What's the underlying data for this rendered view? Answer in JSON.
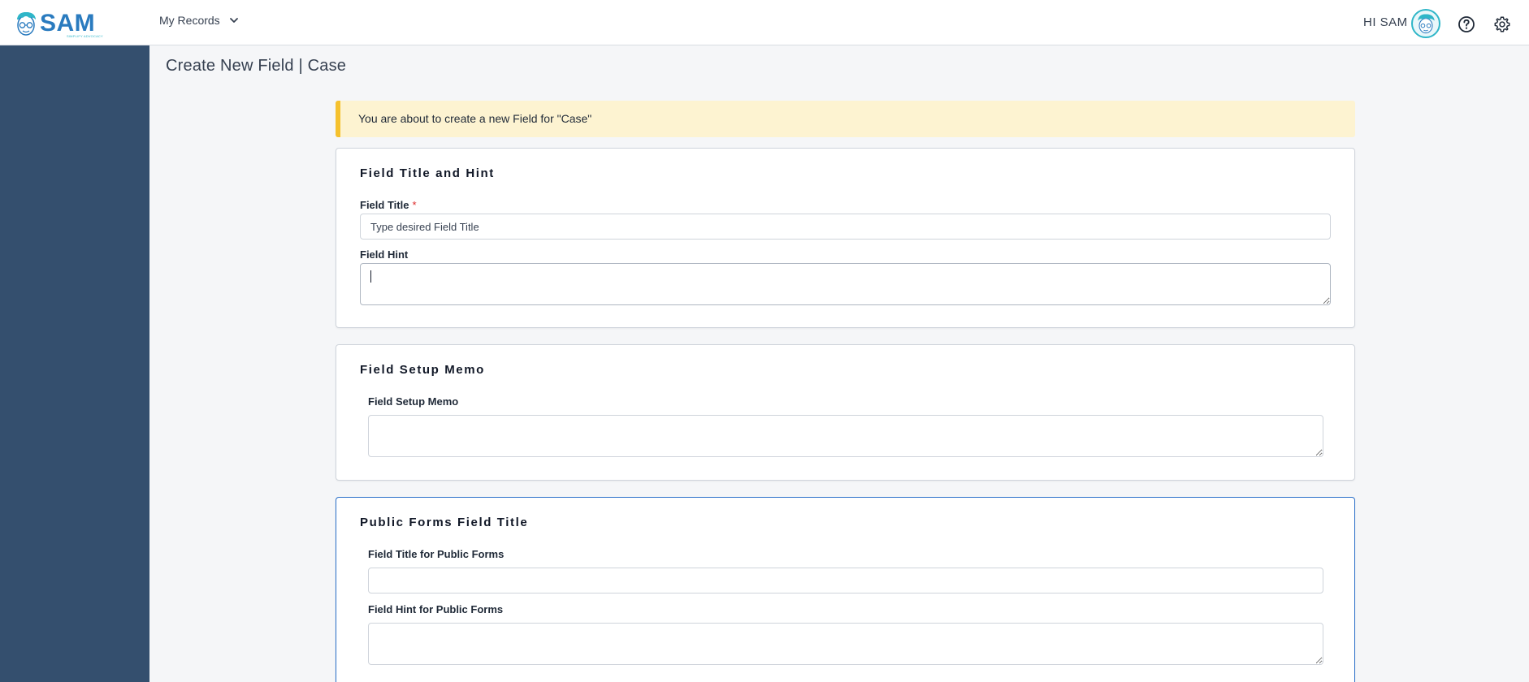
{
  "header": {
    "logo_text": "SAM",
    "logo_tagline": "SIMPLIFY ADVOCACY",
    "nav_menu_label": "My Records",
    "greeting": "HI SAM"
  },
  "page": {
    "title": "Create New Field | Case"
  },
  "alert": {
    "message": "You are about to create a new Field for \"Case\""
  },
  "sections": {
    "title_hint": {
      "heading": "Field Title and Hint",
      "title_label": "Field Title",
      "title_required_mark": "*",
      "title_placeholder": "Type desired Field Title",
      "hint_label": "Field Hint",
      "hint_value": ""
    },
    "setup_memo": {
      "heading": "Field Setup Memo",
      "memo_label": "Field Setup Memo",
      "memo_value": ""
    },
    "public_forms": {
      "heading": "Public Forms Field Title",
      "public_title_label": "Field Title for Public Forms",
      "public_title_value": "",
      "public_hint_label": "Field Hint for Public Forms",
      "public_hint_value": ""
    }
  },
  "colors": {
    "sidebar": "#344f6e",
    "accent": "#2a6fc9",
    "alert_bg": "#fdf3d1",
    "alert_bar": "#f5c12e",
    "required": "#dc2626"
  },
  "icons": {
    "logo": "sam-face-logo-icon",
    "dropdown": "chevron-down-icon",
    "help": "question-circle-icon",
    "settings": "gear-icon",
    "avatar": "user-avatar-icon"
  }
}
